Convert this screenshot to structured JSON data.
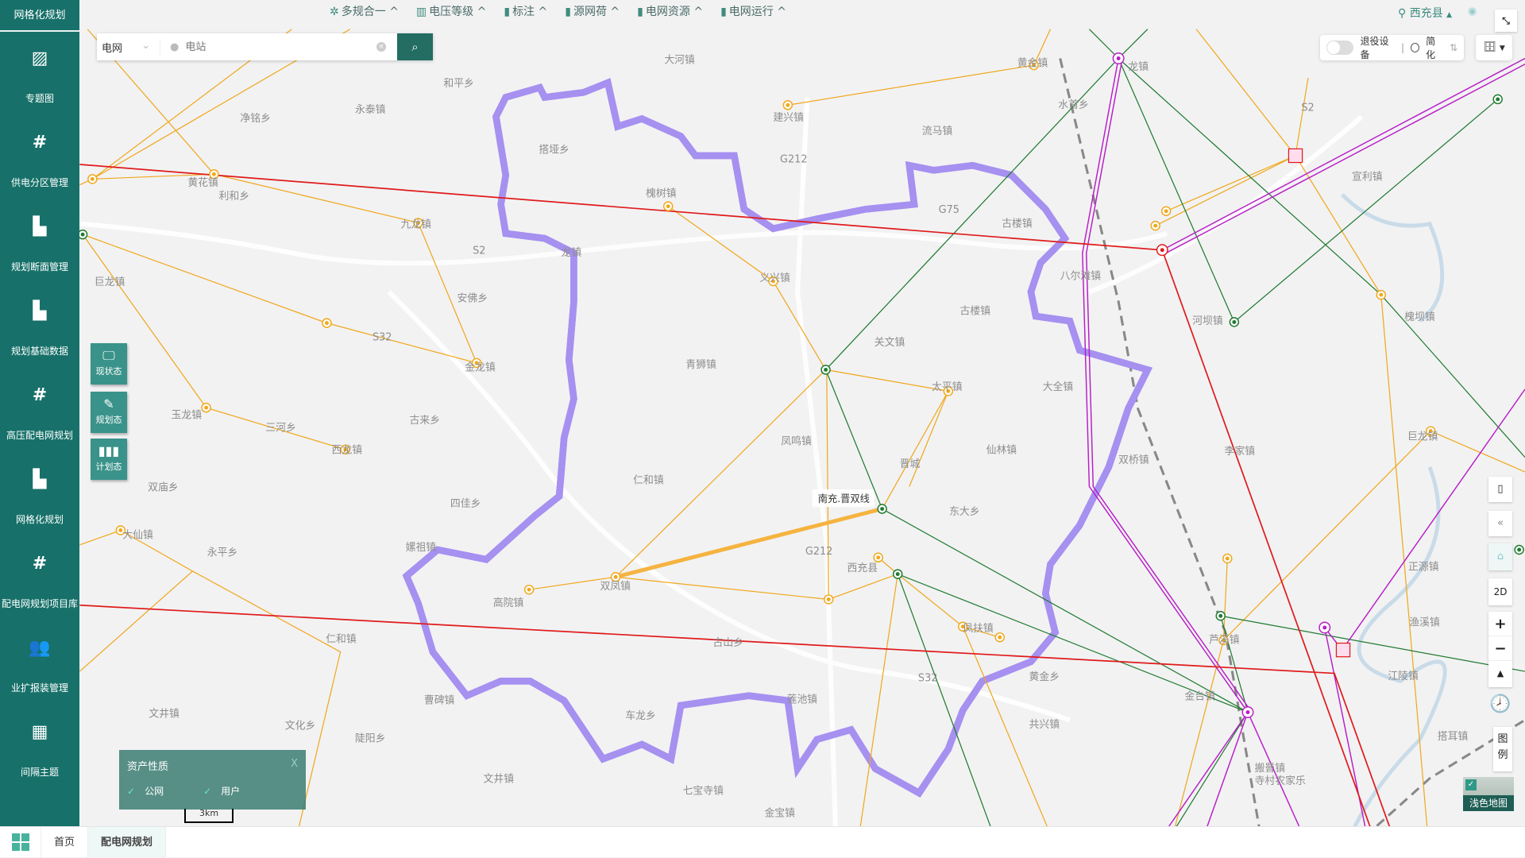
{
  "sidebar": {
    "title": "网格化规划",
    "items": [
      {
        "label": "专题图",
        "icon": "image-icon"
      },
      {
        "label": "供电分区管理",
        "icon": "grid-icon"
      },
      {
        "label": "规划断面管理",
        "icon": "road-icon"
      },
      {
        "label": "规划基础数据",
        "icon": "road-icon"
      },
      {
        "label": "高压配电网规划",
        "icon": "grid-icon"
      },
      {
        "label": "网格化规划",
        "icon": "road-icon"
      },
      {
        "label": "配电网规划项目库",
        "icon": "grid-icon"
      },
      {
        "label": "业扩报装管理",
        "icon": "users-icon"
      },
      {
        "label": "间隔主题",
        "icon": "substation-icon"
      }
    ]
  },
  "toolbar": {
    "items": [
      {
        "label": "多规合一",
        "icon": "gear-icon"
      },
      {
        "label": "电压等级",
        "icon": "voltage-icon"
      },
      {
        "label": "标注",
        "icon": "book-icon"
      },
      {
        "label": "源网荷",
        "icon": "book-icon"
      },
      {
        "label": "电网资源",
        "icon": "book-icon"
      },
      {
        "label": "电网运行",
        "icon": "book-icon"
      }
    ]
  },
  "search": {
    "category": "电网",
    "placeholder": "电站",
    "value": ""
  },
  "location": {
    "name": "西充县"
  },
  "display_toggle": {
    "retired_label": "退役设备",
    "retired_on": false,
    "simplify_label": "简化"
  },
  "state_buttons": [
    {
      "label": "现状态"
    },
    {
      "label": "规划态"
    },
    {
      "label": "计划态"
    }
  ],
  "legend_panel": {
    "title": "资产性质",
    "close": "X",
    "options": [
      {
        "label": "公网",
        "checked": true
      },
      {
        "label": "用户",
        "checked": true
      }
    ]
  },
  "scale": "3km",
  "map_controls": {
    "view_mode": "2D",
    "legend": "图例",
    "basemap": "浅色地图"
  },
  "map": {
    "line_label": "南充.晋双线",
    "colors": {
      "boundary": "#6a3fe0",
      "line_500kv": "#e01a1a",
      "line_220kv": "#b81fc7",
      "line_110kv": "#1f7a2f",
      "line_35kv": "#f0a81c"
    },
    "places": [
      "大河镇",
      "和平乡",
      "永泰镇",
      "净铭乡",
      "搭垭乡",
      "槐树镇",
      "建兴镇",
      "流马镇",
      "G212",
      "黄花镇",
      "利和乡",
      "九龙镇",
      "S2",
      "龙镇",
      "巨龙镇",
      "安佛乡",
      "S32",
      "金龙镇",
      "义兴镇",
      "古楼镇",
      "八尔滩镇",
      "古楼镇",
      "关文镇",
      "青狮镇",
      "太平镇",
      "大全镇",
      "玉龙镇",
      "三河乡",
      "古来乡",
      "西龙镇",
      "凤鸣镇",
      "仙林镇",
      "双桥镇",
      "李家镇",
      "巨龙镇",
      "晋城",
      "仁和镇",
      "四佳乡",
      "东大乡",
      "双庙乡",
      "大仙镇",
      "嫘祖镇",
      "永平乡",
      "G212",
      "西充县",
      "双凤镇",
      "高院镇",
      "凤扶镇",
      "仁和镇",
      "古山乡",
      "黄金乡",
      "莲池镇",
      "曹碑镇",
      "车龙乡",
      "文井镇",
      "文化乡",
      "陡阳乡",
      "共兴镇",
      "文井镇",
      "七宝寺镇",
      "金宝镇",
      "正源镇",
      "渔溪镇",
      "江陵镇",
      "搭耳镇",
      "宣利镇",
      "槐坝镇",
      "河坝镇",
      "水首乡",
      "龙镇",
      "黄金镇",
      "G75",
      "S2",
      "S32",
      "芦溪镇",
      "金台镇",
      "搬罾镇",
      "寺村农家乐"
    ]
  },
  "bottom_tabs": [
    {
      "label": "首页"
    },
    {
      "label": "配电网规划",
      "active": true
    }
  ]
}
